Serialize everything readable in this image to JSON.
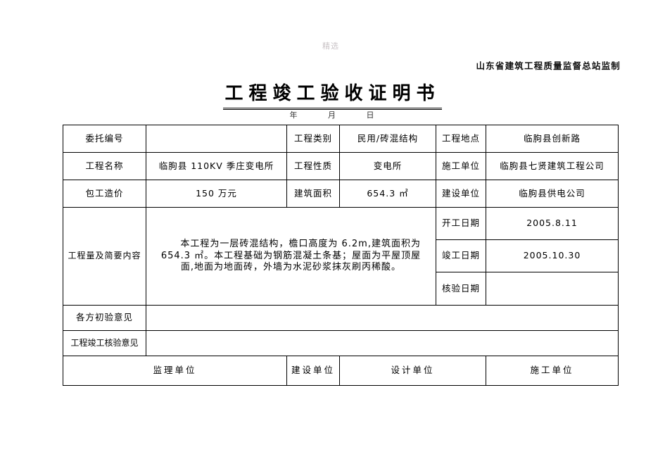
{
  "watermark": "精选",
  "header": {
    "institution_line": "山东省建筑工程质量监督总站监制"
  },
  "title": {
    "text": "工程竣工验收证明书",
    "date_year": "年",
    "date_month": "月",
    "date_day": "日"
  },
  "table": {
    "row1": {
      "label1": "委托编号",
      "value1": "",
      "label2": "工程类别",
      "value2": "民用/砖混结构",
      "label3": "工程地点",
      "value3": "临朐县创新路"
    },
    "row2": {
      "label1": "工程名称",
      "value1": "临朐县 110KV 季庄变电所",
      "label2": "工程性质",
      "value2": "变电所",
      "label3": "施工单位",
      "value3": "临朐县七贤建筑工程公司"
    },
    "row3": {
      "label1": "包工造价",
      "value1": "150 万元",
      "label2": "建筑面积",
      "value2": "654.3 ㎡",
      "label3": "建设单位",
      "value3": "临朐县供电公司"
    },
    "content": {
      "label": "工程量及简要内容",
      "line1": "本工程为一层砖混结构，檐口高度为 6.2m,建筑面积为",
      "line2": "654.3 ㎡。本工程基础为钢筋混凝土条基；屋面为平屋顶屋",
      "line3": "面,地面为地面砖，外墙为水泥砂浆抹灰刷丙稀酸。"
    },
    "dates": {
      "start_label": "开工日期",
      "start_value": "2005.8.11",
      "finish_label": "竣工日期",
      "finish_value": "2005.10.30",
      "check_label": "核验日期",
      "check_value": ""
    },
    "opinions": {
      "preliminary_label": "各方初验意见",
      "preliminary_value": "",
      "final_label": "工程竣工核验意见",
      "final_value": ""
    },
    "signatures": {
      "supervision": "监理单位",
      "construction_owner": "建设单位",
      "design": "设计单位",
      "contractor": "施工单位"
    }
  }
}
